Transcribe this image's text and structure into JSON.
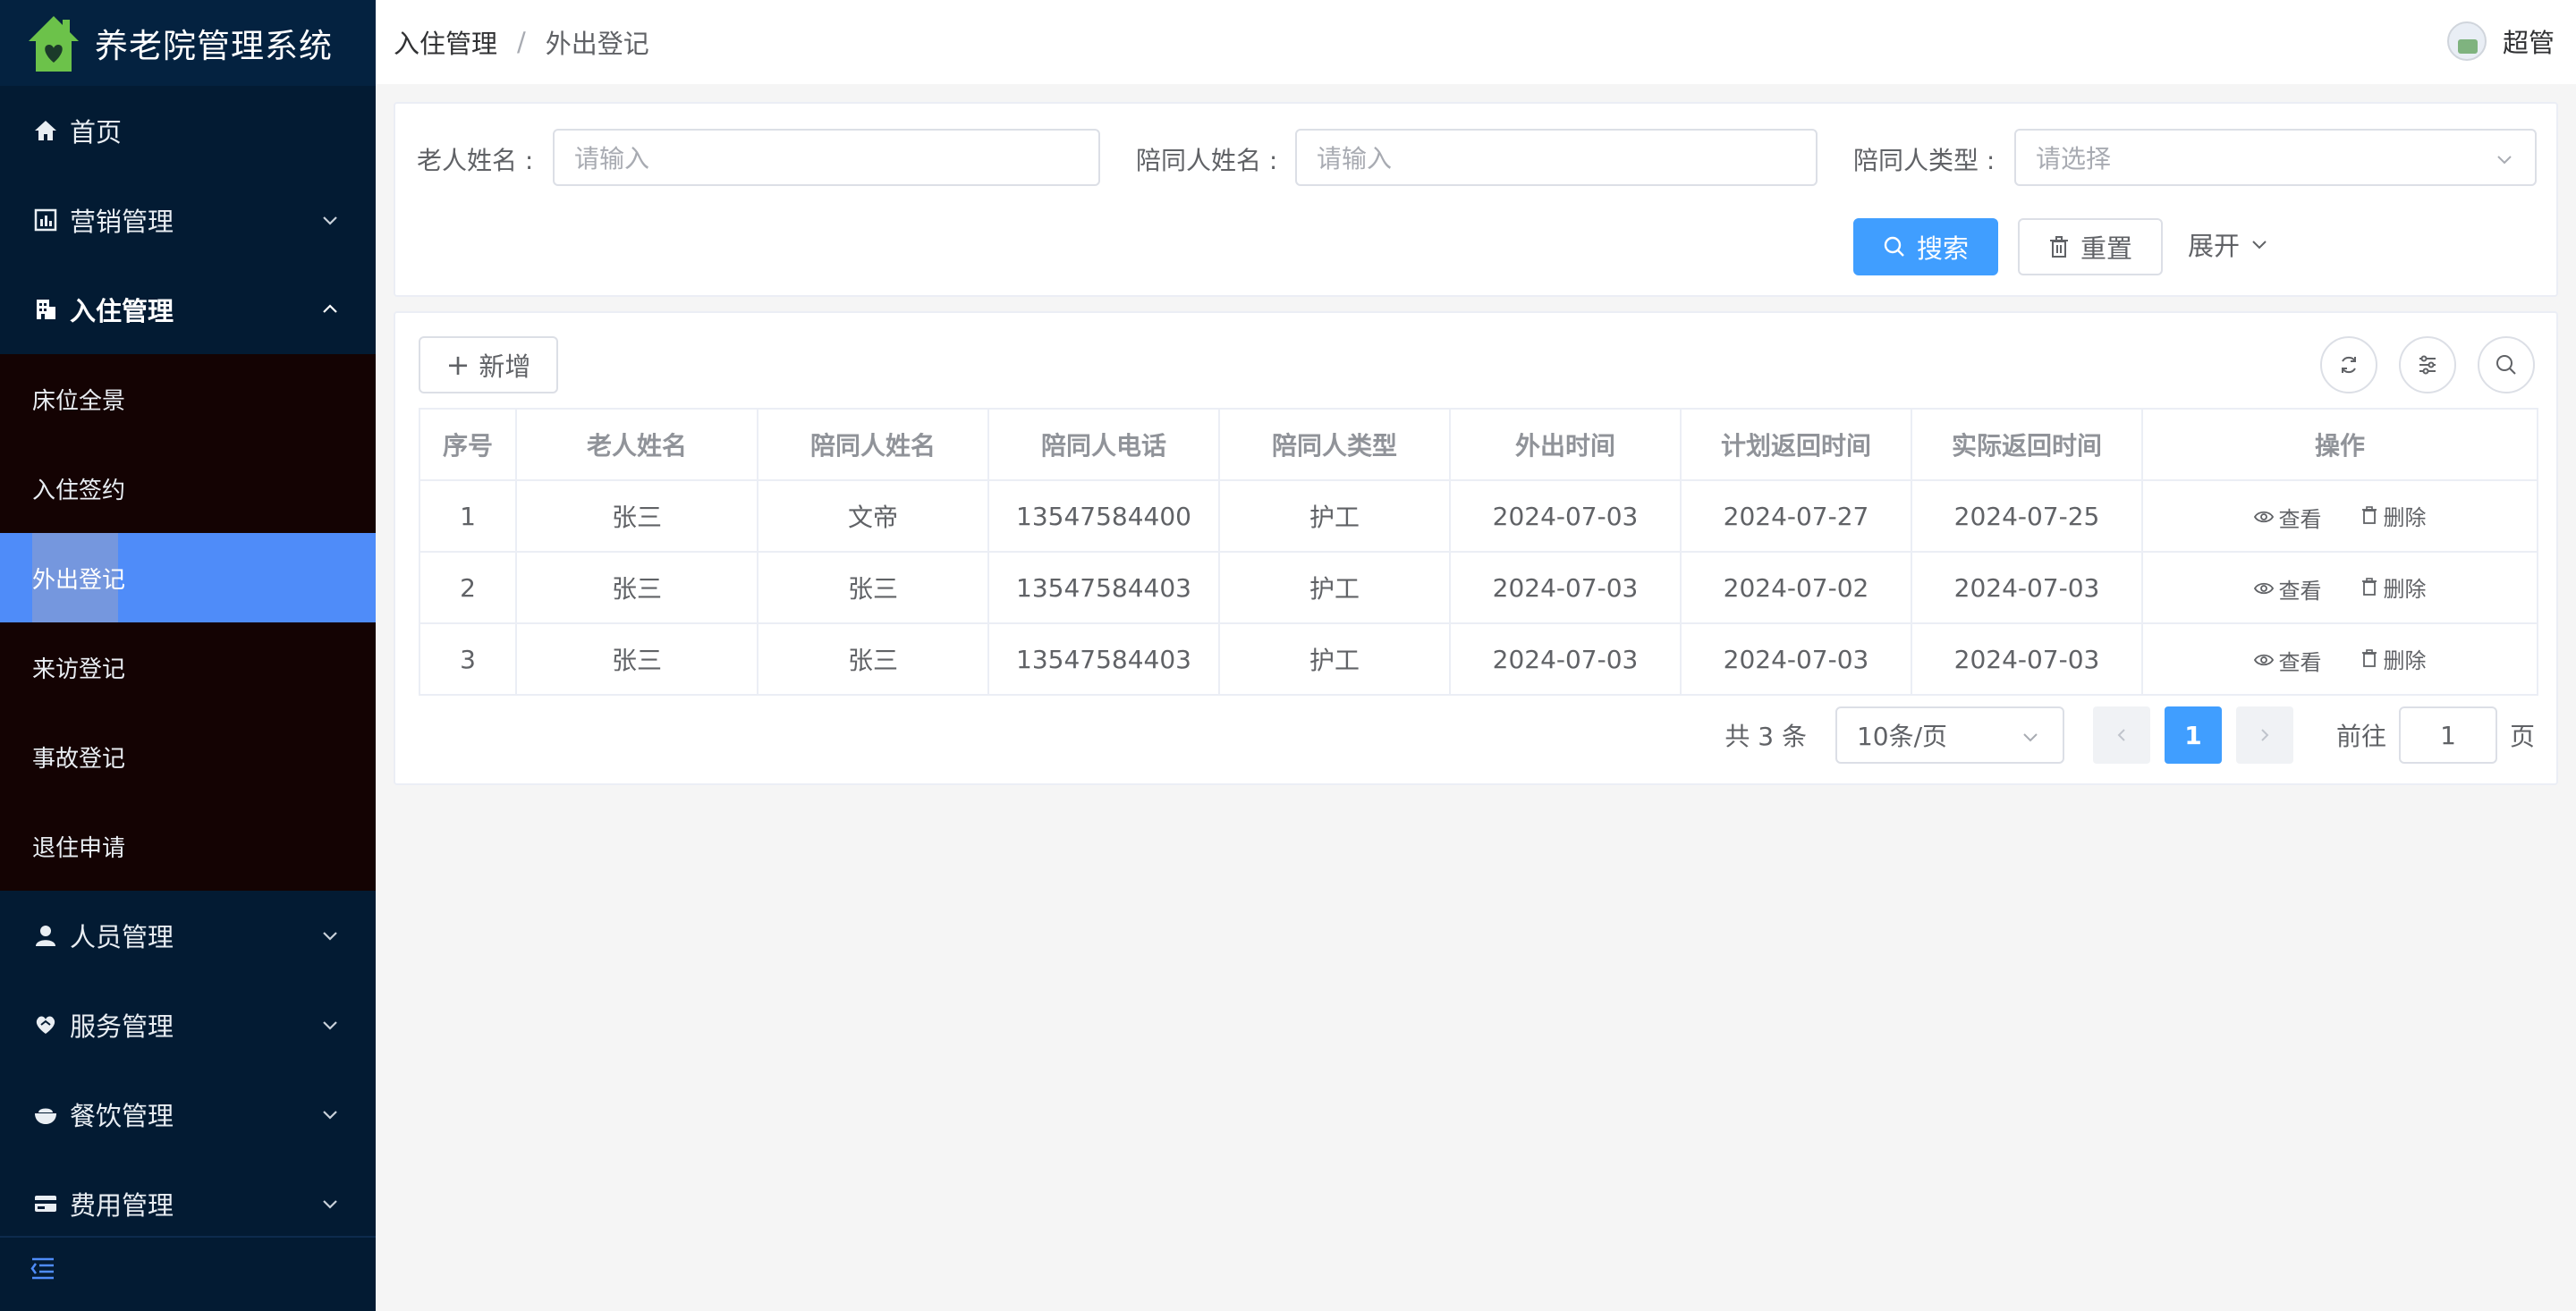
{
  "app": {
    "title": "养老院管理系统"
  },
  "sidebar": {
    "items": [
      {
        "label": "首页",
        "icon": "home-icon"
      },
      {
        "label": "营销管理",
        "icon": "chart-icon"
      },
      {
        "label": "入住管理",
        "icon": "building-icon"
      }
    ],
    "sub_items": [
      {
        "label": "床位全景"
      },
      {
        "label": "入住签约"
      },
      {
        "label": "外出登记",
        "active": true
      },
      {
        "label": "来访登记"
      },
      {
        "label": "事故登记"
      },
      {
        "label": "退住申请"
      }
    ],
    "bottom_items": [
      {
        "label": "人员管理",
        "icon": "user-icon"
      },
      {
        "label": "服务管理",
        "icon": "heart-hand-icon"
      },
      {
        "label": "餐饮管理",
        "icon": "bowl-icon"
      },
      {
        "label": "费用管理",
        "icon": "card-icon"
      }
    ]
  },
  "header": {
    "breadcrumb": [
      "入住管理",
      "外出登记"
    ],
    "separator": "/",
    "user_name": "超管"
  },
  "search": {
    "elder_label": "老人姓名 :",
    "elder_placeholder": "请输入",
    "companion_label": "陪同人姓名 :",
    "companion_placeholder": "请输入",
    "type_label": "陪同人类型 :",
    "type_placeholder": "请选择",
    "search_button": "搜索",
    "reset_button": "重置",
    "expand_label": "展开"
  },
  "toolbar": {
    "add_button": "新增"
  },
  "table": {
    "columns": [
      "序号",
      "老人姓名",
      "陪同人姓名",
      "陪同人电话",
      "陪同人类型",
      "外出时间",
      "计划返回时间",
      "实际返回时间",
      "操作"
    ],
    "rows": [
      [
        "1",
        "张三",
        "文帝",
        "13547584400",
        "护工",
        "2024-07-03",
        "2024-07-27",
        "2024-07-25"
      ],
      [
        "2",
        "张三",
        "张三",
        "13547584403",
        "护工",
        "2024-07-03",
        "2024-07-02",
        "2024-07-03"
      ],
      [
        "3",
        "张三",
        "张三",
        "13547584403",
        "护工",
        "2024-07-03",
        "2024-07-03",
        "2024-07-03"
      ]
    ],
    "view_label": "查看",
    "delete_label": "删除"
  },
  "pagination": {
    "total_text": "共 3 条",
    "page_size": "10条/页",
    "current_page": "1",
    "goto_label": "前往",
    "goto_value": "1",
    "goto_unit": "页"
  },
  "colors": {
    "sidebar_bg": "#031b33",
    "submenu_bg": "#140303",
    "active_bg": "#4f8cf9",
    "primary": "#409eff"
  }
}
